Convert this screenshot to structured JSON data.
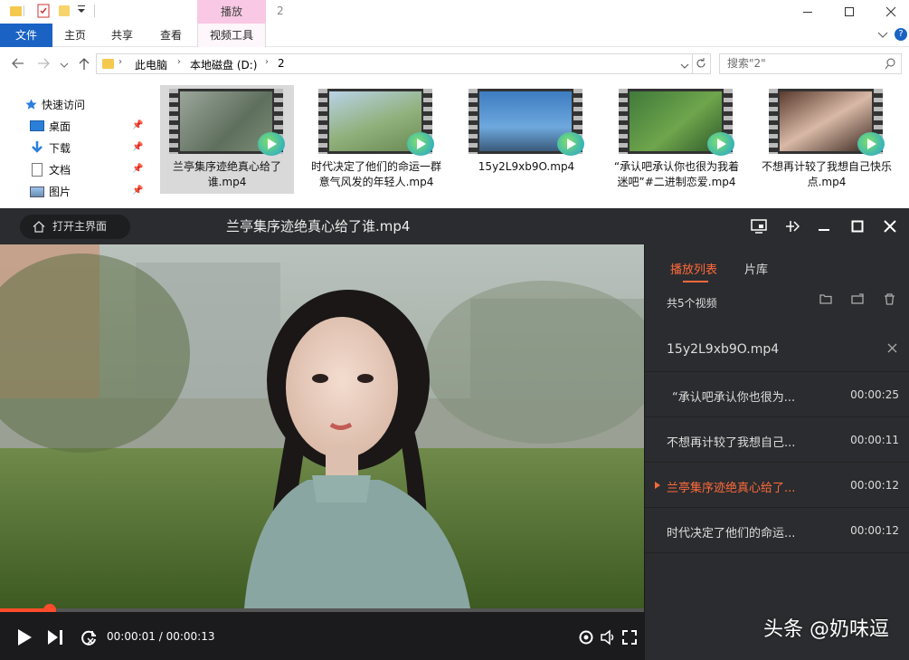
{
  "explorer": {
    "contextual_tab": "播放",
    "title": "2",
    "ribbon_tabs": [
      "文件",
      "主页",
      "共享",
      "查看",
      "视频工具"
    ],
    "address": [
      "此电脑",
      "本地磁盘 (D:)",
      "2"
    ],
    "search_placeholder": "搜索\"2\"",
    "nav": {
      "quick_access": "快速访问",
      "items": [
        "桌面",
        "下载",
        "文档",
        "图片"
      ]
    },
    "files": [
      {
        "name": "兰亭集序迹绝真心给了谁.mp4",
        "selected": true
      },
      {
        "name": "时代决定了他们的命运一群意气风发的年轻人.mp4",
        "selected": false
      },
      {
        "name": "15y2L9xb9O.mp4",
        "selected": false
      },
      {
        "name": "“承认吧承认你也很为我着迷吧”#二进制恋爱.mp4",
        "selected": false
      },
      {
        "name": "不想再计较了我想自己快乐点.mp4",
        "selected": false
      }
    ]
  },
  "player": {
    "home_label": "打开主界面",
    "title": "兰亭集序迹绝真心给了谁.mp4",
    "time_current": "00:00:01",
    "time_total": "00:00:13",
    "time_display": "00:00:01 / 00:00:13",
    "progress": 0.077,
    "side": {
      "tabs": [
        "播放列表",
        "片库"
      ],
      "count": "共5个视频",
      "playlist": [
        {
          "name": "15y2L9xb9O.mp4",
          "duration": "",
          "active": false
        },
        {
          "name": "“承认吧承认你也很为...",
          "duration": "00:00:25",
          "active": false
        },
        {
          "name": "不想再计较了我想自己...",
          "duration": "00:00:11",
          "active": false
        },
        {
          "name": "兰亭集序迹绝真心给了...",
          "duration": "00:00:12",
          "active": true
        },
        {
          "name": "时代决定了他们的命运...",
          "duration": "00:00:12",
          "active": false
        }
      ]
    }
  },
  "watermark": "头条 @奶味逗",
  "colors": {
    "accent": "#ff6a3b",
    "file_tab": "#1a63c4",
    "player_bg": "#2b2c2f"
  }
}
